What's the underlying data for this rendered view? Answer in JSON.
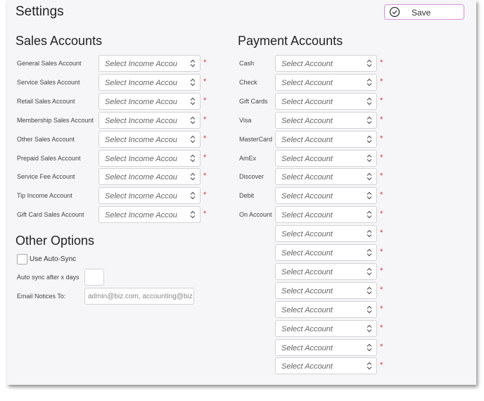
{
  "page": {
    "title": "Settings",
    "save_label": "Save"
  },
  "sales": {
    "heading": "Sales Accounts",
    "placeholder": "Select Income Account",
    "required_mark": "*",
    "rows": [
      "General Sales Account",
      "Service Sales Account",
      "Retail Sales Account",
      "Membership Sales Account",
      "Other Sales Account",
      "Prepaid Sales Account",
      "Service Fee Account",
      "Tip Income Account",
      "Gift Card Sales Account"
    ]
  },
  "payment": {
    "heading": "Payment Accounts",
    "placeholder": "Select Account",
    "required_mark": "*",
    "rows": [
      "Cash",
      "Check",
      "Gift Cards",
      "Visa",
      "MasterCard",
      "AmEx",
      "Discover",
      "Debit",
      "On Account",
      "",
      "",
      "",
      "",
      "",
      "",
      "",
      ""
    ]
  },
  "options": {
    "heading": "Other Options",
    "auto_sync_label": "Use Auto-Sync",
    "auto_sync_checked": false,
    "days_label": "Auto sync after x days",
    "days_value": "",
    "email_label": "Email Notices To:",
    "email_placeholder": "admin@biz.com, accounting@biz.com"
  },
  "colors": {
    "accent_border": "#d68fd8",
    "required": "#e03030",
    "panel_bg": "#f6f6f9"
  }
}
